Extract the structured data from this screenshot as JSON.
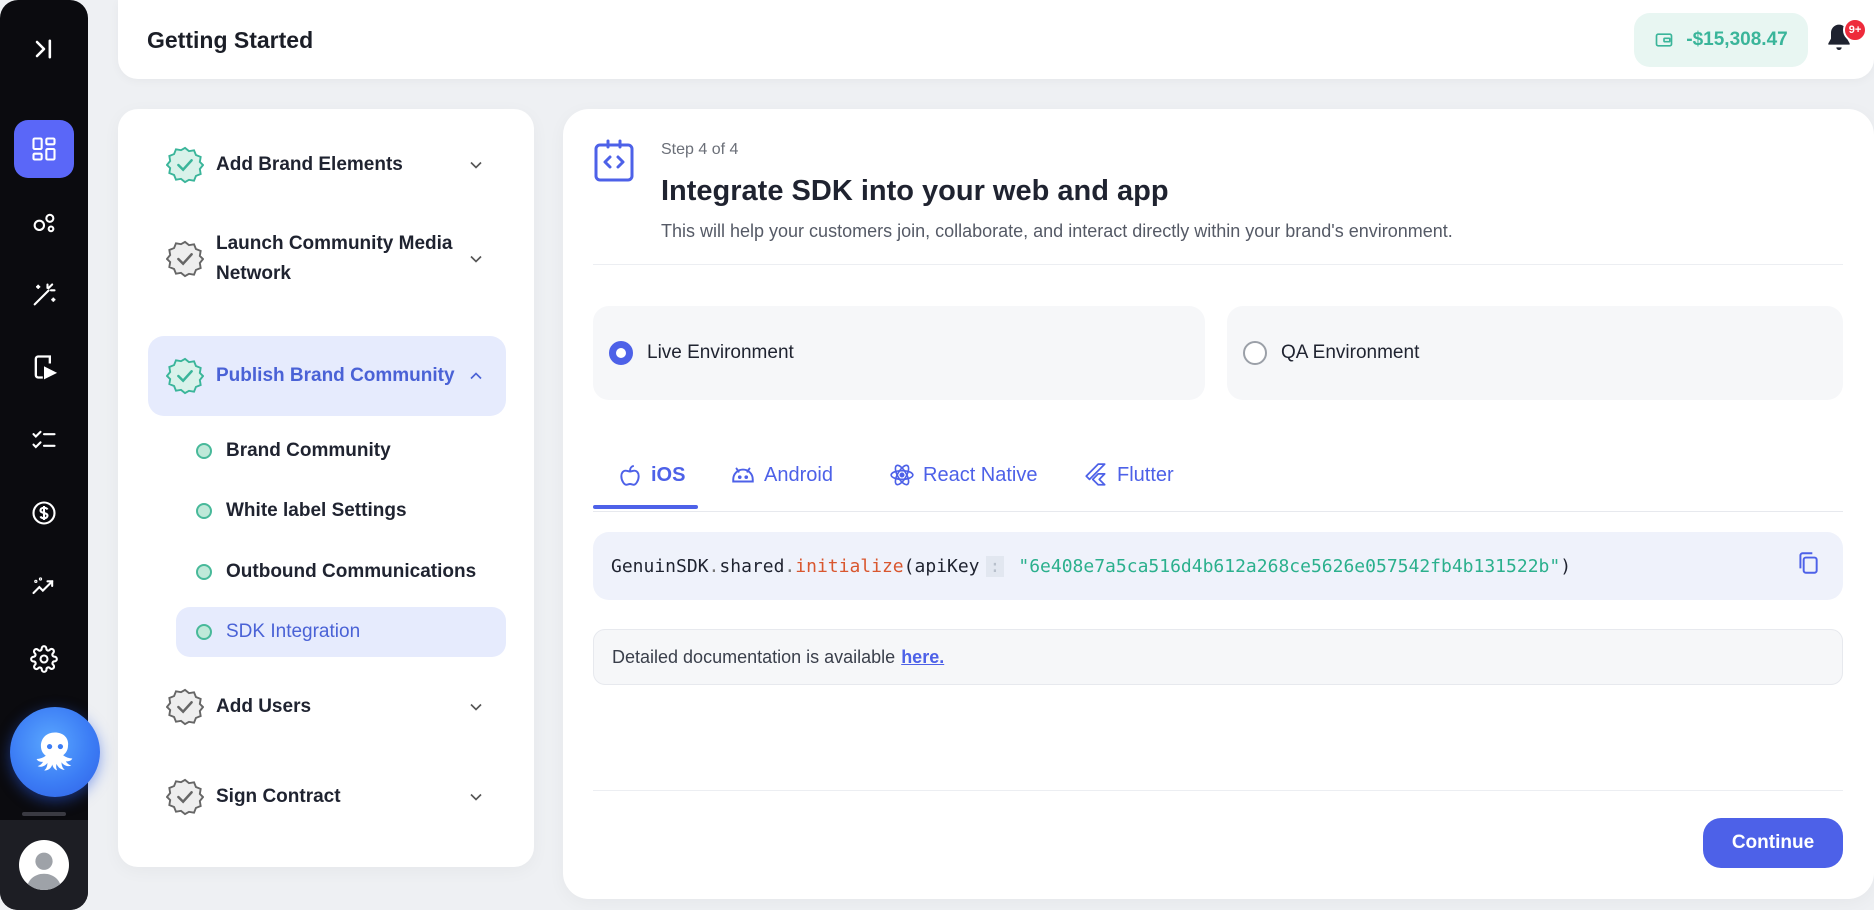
{
  "header": {
    "title": "Getting Started",
    "balance": "-$15,308.47",
    "notification_badge": "9+"
  },
  "rail": {
    "items": [
      "expand-icon",
      "dashboard-icon",
      "community-icon",
      "magic-wand-icon",
      "video-device-icon",
      "checklist-icon",
      "dollar-icon",
      "analytics-icon",
      "gear-icon"
    ],
    "active_item": "dashboard-icon"
  },
  "steps": {
    "items": [
      {
        "label": "Add Brand Elements",
        "status": "complete",
        "expanded": false
      },
      {
        "label": "Launch Community Media Network",
        "status": "pending",
        "expanded": false
      },
      {
        "label": "Publish Brand Community",
        "status": "complete",
        "expanded": true
      },
      {
        "label": "Add Users",
        "status": "pending",
        "expanded": false
      },
      {
        "label": "Sign Contract",
        "status": "pending",
        "expanded": false
      }
    ],
    "subitems": [
      {
        "label": "Brand Community"
      },
      {
        "label": "White label Settings"
      },
      {
        "label": "Outbound Communications"
      },
      {
        "label": "SDK Integration",
        "active": true
      }
    ]
  },
  "main": {
    "step_count": "Step 4 of 4",
    "title": "Integrate SDK into your web and app",
    "description": "This will help your customers join, collaborate, and interact directly within your brand's environment.",
    "environments": [
      {
        "label": "Live Environment",
        "selected": true
      },
      {
        "label": "QA Environment",
        "selected": false
      }
    ],
    "tabs": [
      {
        "label": "iOS",
        "icon": "apple-icon",
        "active": true
      },
      {
        "label": "Android",
        "icon": "android-icon",
        "active": false
      },
      {
        "label": "React Native",
        "icon": "react-icon",
        "active": false
      },
      {
        "label": "Flutter",
        "icon": "flutter-icon",
        "active": false
      }
    ],
    "code": {
      "obj": "GenuinSDK",
      "dot1": ".",
      "prop": "shared",
      "dot2": ".",
      "fn": "initialize",
      "open": "(",
      "param": "apiKey",
      "colon": ":",
      "value": "\"6e408e7a5ca516d4b612a268ce5626e057542fb4b131522b\"",
      "close": ")"
    },
    "docs_text": "Detailed documentation is available",
    "docs_link": "here.",
    "continue_label": "Continue"
  },
  "colors": {
    "accent": "#4d61e8",
    "success": "#3ab59a",
    "rail_bg": "#0b0b0f"
  }
}
